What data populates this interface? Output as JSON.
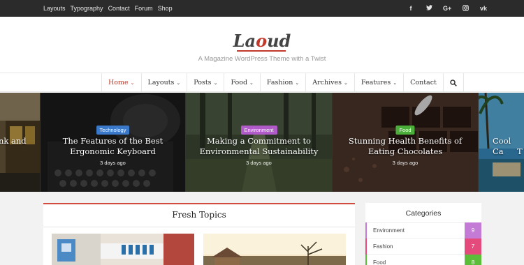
{
  "topbar": {
    "links": [
      "Layouts",
      "Typography",
      "Contact",
      "Forum",
      "Shop"
    ],
    "social": [
      {
        "icon": "facebook-icon",
        "glyph": "f"
      },
      {
        "icon": "twitter-icon",
        "glyph": "t"
      },
      {
        "icon": "googleplus-icon",
        "glyph": "G+"
      },
      {
        "icon": "instagram-icon",
        "glyph": "◎"
      },
      {
        "icon": "vk-icon",
        "glyph": "vk"
      }
    ]
  },
  "header": {
    "logo_pre": "La",
    "logo_accent": "o",
    "logo_post": "ud",
    "tagline": "A Magazine WordPress Theme with a Twist",
    "accent_color": "#c0392b"
  },
  "nav": {
    "items": [
      {
        "label": "Home",
        "dropdown": true,
        "active": true
      },
      {
        "label": "Layouts",
        "dropdown": true
      },
      {
        "label": "Posts",
        "dropdown": true
      },
      {
        "label": "Food",
        "dropdown": true
      },
      {
        "label": "Fashion",
        "dropdown": true
      },
      {
        "label": "Archives",
        "dropdown": true
      },
      {
        "label": "Features",
        "dropdown": true
      },
      {
        "label": "Contact",
        "dropdown": false
      }
    ],
    "search_icon": "search-icon"
  },
  "slider": {
    "partial_left": {
      "title": "nk and"
    },
    "slides": [
      {
        "category": "Technology",
        "category_color": "#3a78c9",
        "title": "The Features of the Best Ergonomic Keyboard",
        "date": "3 days ago"
      },
      {
        "category": "Environment",
        "category_color": "#b15bc9",
        "title": "Making a Commitment to Environmental Sustainability",
        "date": "3 days ago"
      },
      {
        "category": "Food",
        "category_color": "#4cae3a",
        "title": "Stunning Health Benefits of Eating Chocolates",
        "date": "3 days ago"
      }
    ],
    "partial_right": {
      "title": "Cool Ca",
      "title2": "T"
    }
  },
  "fresh": {
    "title": "Fresh Topics",
    "accent_color": "#d24b3f"
  },
  "categories": {
    "title": "Categories",
    "items": [
      {
        "name": "Environment",
        "count": "9",
        "color": "#c47bd6"
      },
      {
        "name": "Fashion",
        "count": "7",
        "color": "#e54a7c"
      },
      {
        "name": "Food",
        "count": "8",
        "color": "#5cbd3b"
      }
    ]
  }
}
